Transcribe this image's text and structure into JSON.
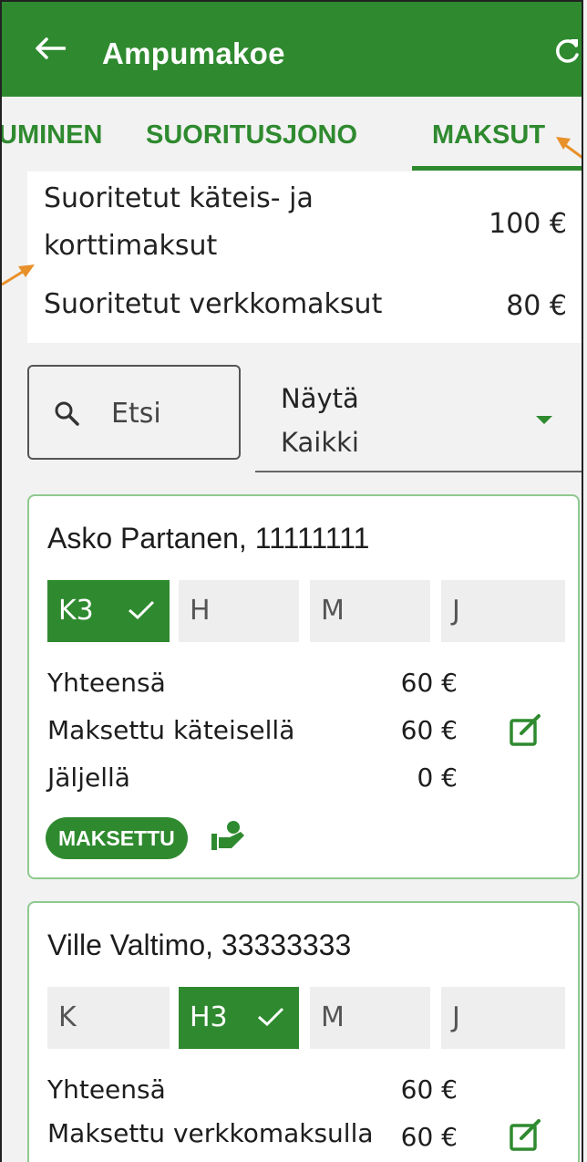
{
  "appbar": {
    "title": "Ampumakoe"
  },
  "tabs": [
    {
      "label": "UMINEN"
    },
    {
      "label": "SUORITUSJONO"
    },
    {
      "label": "MAKSUT"
    }
  ],
  "summary": {
    "cash_card_label_line1": "Suoritetut käteis- ja",
    "cash_card_label_line2": "korttimaksut",
    "cash_card_value": "100 €",
    "online_label": "Suoritetut verkkomaksut",
    "online_value": "80 €"
  },
  "search": {
    "placeholder": "Etsi"
  },
  "filter": {
    "label": "Näytä",
    "value": "Kaikki"
  },
  "people": [
    {
      "name": "Asko Partanen, 11111111",
      "chips": [
        "K3",
        "H",
        "M",
        "J"
      ],
      "active_chip": 0,
      "total_label": "Yhteensä",
      "total_value": "60 €",
      "paid_label": "Maksettu käteisellä",
      "paid_value": "60 €",
      "remaining_label": "Jäljellä",
      "remaining_value": "0 €",
      "status_badge": "MAKSETTU"
    },
    {
      "name": "Ville Valtimo, 33333333",
      "chips": [
        "K",
        "H3",
        "M",
        "J"
      ],
      "active_chip": 1,
      "total_label": "Yhteensä",
      "total_value": "60 €",
      "paid_label": "Maksettu verkkomaksulla",
      "paid_value": "60 €"
    }
  ],
  "colors": {
    "primary": "#2f8a2f",
    "annotation": "#e8902a"
  }
}
